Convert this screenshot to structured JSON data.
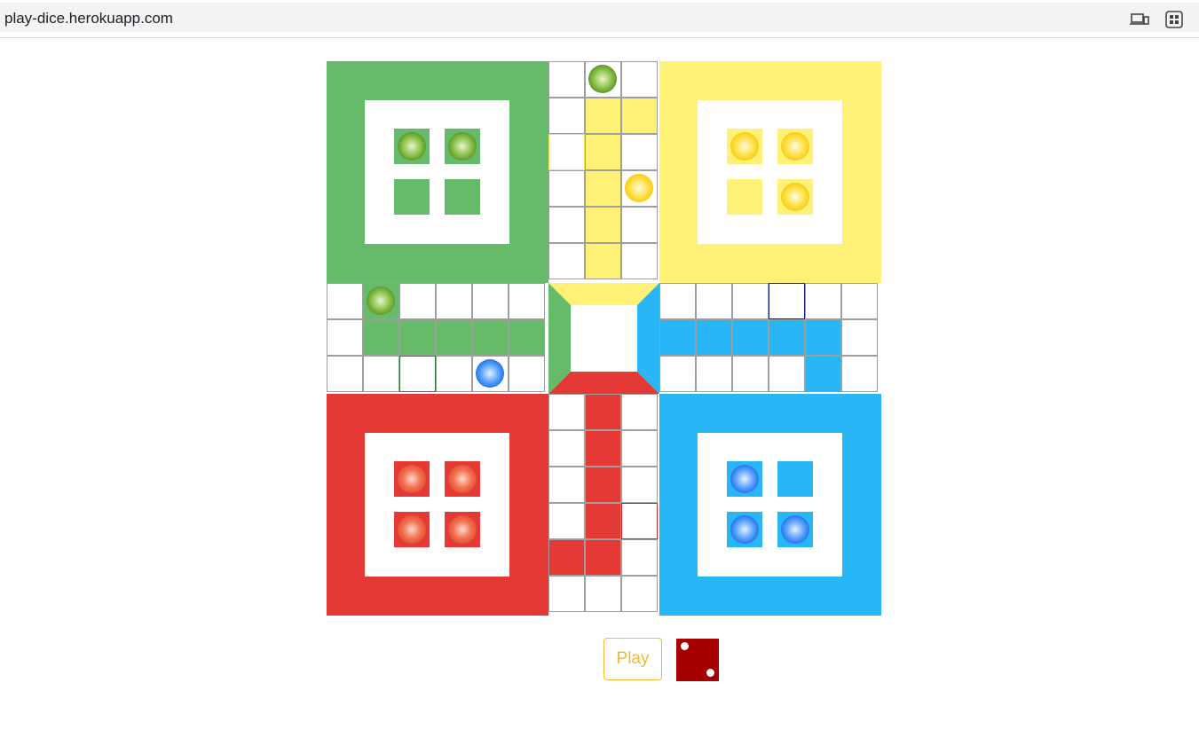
{
  "browser": {
    "url": "play-dice.herokuapp.com",
    "icons": [
      "devices-icon",
      "extensions-icon"
    ]
  },
  "colors": {
    "green": "#66bb6a",
    "yellow": "#fff176",
    "red": "#e53935",
    "blue": "#29b6f6",
    "dice": "#a80000",
    "play_button": "#f5b630"
  },
  "board": {
    "homes": {
      "green": {
        "tokens_at_home": 2
      },
      "yellow": {
        "tokens_at_home": 3
      },
      "red": {
        "tokens_at_home": 4
      },
      "blue": {
        "tokens_at_home": 3
      }
    },
    "tokens_on_track": [
      "green",
      "green",
      "yellow",
      "blue"
    ]
  },
  "controls": {
    "play_label": "Play",
    "dice_value": 2
  }
}
